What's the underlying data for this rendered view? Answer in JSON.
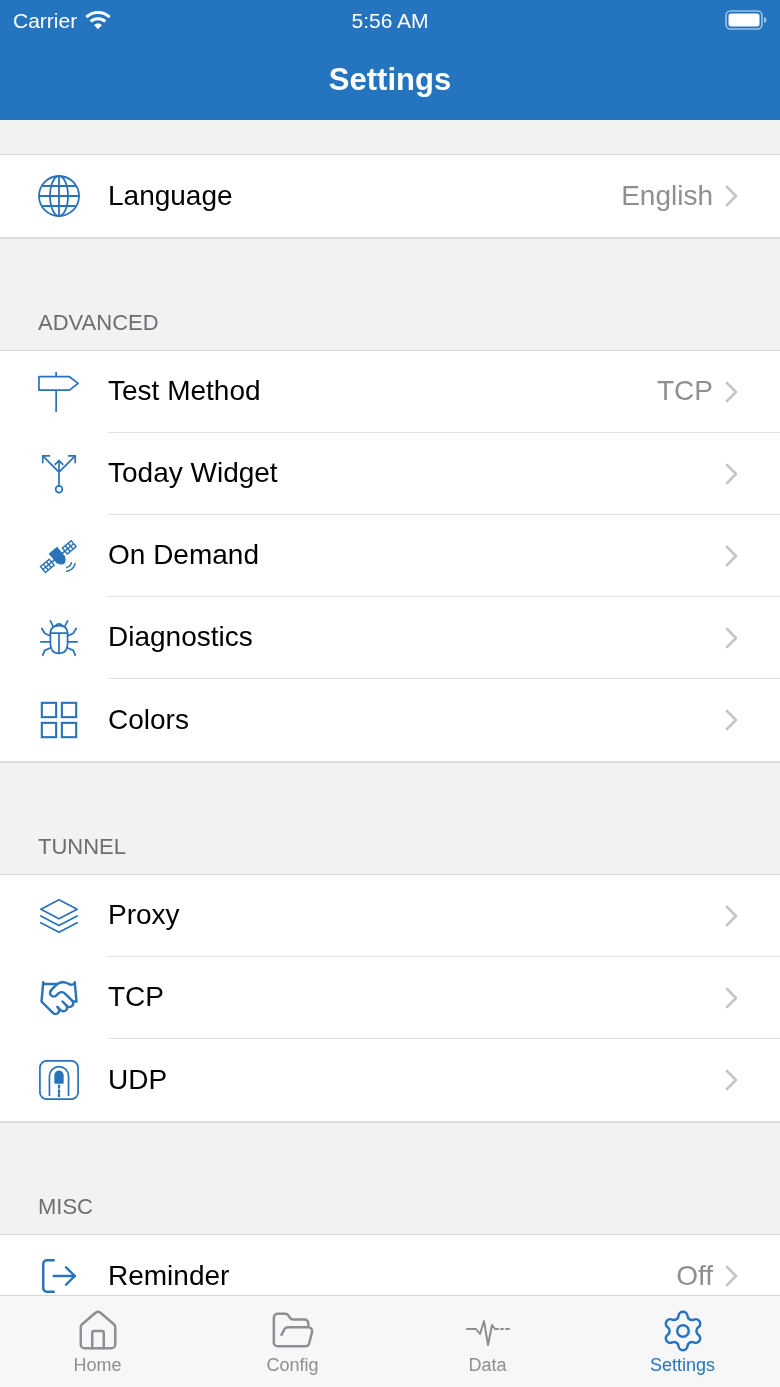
{
  "status_bar": {
    "carrier": "Carrier",
    "time": "5:56 AM"
  },
  "nav_bar": {
    "title": "Settings"
  },
  "sections": [
    {
      "rows": [
        {
          "label": "Language",
          "value": "English"
        }
      ]
    },
    {
      "header": "ADVANCED",
      "rows": [
        {
          "label": "Test Method",
          "value": "TCP"
        },
        {
          "label": "Today Widget"
        },
        {
          "label": "On Demand"
        },
        {
          "label": "Diagnostics"
        },
        {
          "label": "Colors"
        }
      ]
    },
    {
      "header": "TUNNEL",
      "rows": [
        {
          "label": "Proxy"
        },
        {
          "label": "TCP"
        },
        {
          "label": "UDP"
        }
      ]
    },
    {
      "header": "MISC",
      "rows": [
        {
          "label": "Reminder",
          "value": "Off"
        }
      ]
    }
  ],
  "tabs": [
    {
      "label": "Home",
      "selected": false
    },
    {
      "label": "Config",
      "selected": false
    },
    {
      "label": "Data",
      "selected": false
    },
    {
      "label": "Settings",
      "selected": true
    }
  ]
}
